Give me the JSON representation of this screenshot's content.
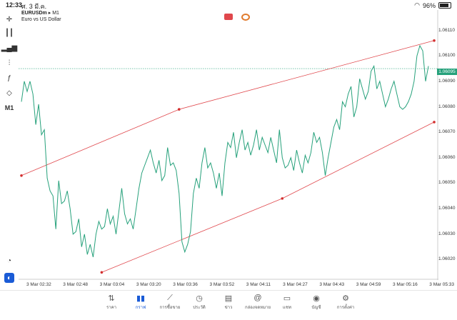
{
  "status_bar": {
    "time": "12:33",
    "date": "ศ. 3 มี.ค.",
    "battery": "96%"
  },
  "symbol": {
    "name": "EURUSDm",
    "timeframe": "M1",
    "description": "Euro vs US Dollar"
  },
  "sidebar": {
    "timeframe_label": "M1"
  },
  "price_axis": {
    "labels": [
      "1.06110",
      "1.06100",
      "1.06090",
      "1.06080",
      "1.06070",
      "1.06060",
      "1.06050",
      "1.06040",
      "1.06030",
      "1.06020"
    ],
    "current_price": "1.06095"
  },
  "time_axis": {
    "labels": [
      "3 Mar 02:32",
      "3 Mar 02:48",
      "3 Mar 03:04",
      "3 Mar 03:20",
      "3 Mar 03:36",
      "3 Mar 03:52",
      "3 Mar 04:11",
      "3 Mar 04:27",
      "3 Mar 04:43",
      "3 Mar 04:59",
      "3 Mar 05:16",
      "3 Mar 05:33"
    ]
  },
  "colors": {
    "line": "#26a17b",
    "channel": "#e0474c",
    "accent": "#1a5bd6"
  },
  "chart_data": {
    "type": "line",
    "x_unit": "time index (minutes)",
    "ylim": [
      1.06012,
      1.06118
    ],
    "series": [
      {
        "values": [
          1.06082,
          1.0609,
          1.06086,
          1.0609,
          1.06085,
          1.06073,
          1.06081,
          1.06069,
          1.06071,
          1.06052,
          1.06047,
          1.06045,
          1.06032,
          1.06051,
          1.06042,
          1.06043,
          1.06047,
          1.0604,
          1.0603,
          1.06031,
          1.06036,
          1.06025,
          1.0603,
          1.06022,
          1.06026,
          1.06021,
          1.0603,
          1.06035,
          1.06032,
          1.06033,
          1.0604,
          1.06034,
          1.06037,
          1.0603,
          1.06039,
          1.06048,
          1.06038,
          1.06034,
          1.06036,
          1.06032,
          1.0604,
          1.06048,
          1.06054,
          1.06057,
          1.0606,
          1.06063,
          1.06058,
          1.06054,
          1.06059,
          1.06051,
          1.06053,
          1.06064,
          1.06057,
          1.06058,
          1.06055,
          1.06046,
          1.06027,
          1.06023,
          1.06026,
          1.06031,
          1.06046,
          1.06052,
          1.06048,
          1.06058,
          1.06064,
          1.06056,
          1.06058,
          1.06054,
          1.06048,
          1.06054,
          1.06045,
          1.06058,
          1.06066,
          1.06064,
          1.0607,
          1.0606,
          1.06066,
          1.06071,
          1.06063,
          1.06066,
          1.06061,
          1.06065,
          1.06071,
          1.06063,
          1.06068,
          1.06065,
          1.06062,
          1.06068,
          1.06063,
          1.06058,
          1.06071,
          1.0606,
          1.06056,
          1.06057,
          1.0606,
          1.06055,
          1.06063,
          1.06058,
          1.06054,
          1.06061,
          1.06058,
          1.06062,
          1.0607,
          1.06066,
          1.06068,
          1.06062,
          1.06053,
          1.0606,
          1.06066,
          1.06072,
          1.06075,
          1.06071,
          1.06082,
          1.0608,
          1.06085,
          1.06088,
          1.06076,
          1.0608,
          1.06091,
          1.06087,
          1.06083,
          1.06086,
          1.06094,
          1.06096,
          1.06087,
          1.0609,
          1.06085,
          1.0608,
          1.06083,
          1.06087,
          1.0609,
          1.06085,
          1.0608,
          1.06079,
          1.0608,
          1.06082,
          1.06085,
          1.0609,
          1.061,
          1.06104,
          1.06102,
          1.0609,
          1.06096
        ]
      }
    ],
    "channel": {
      "upper": [
        {
          "x": 0,
          "y": 1.06053
        },
        {
          "x": 55,
          "y": 1.06079
        },
        {
          "x": 144,
          "y": 1.06106
        }
      ],
      "lower": [
        {
          "x": 28,
          "y": 1.06015
        },
        {
          "x": 91,
          "y": 1.06044
        },
        {
          "x": 144,
          "y": 1.06074
        }
      ]
    }
  },
  "tabs": [
    {
      "label": "ราคา",
      "icon": "sort-icon",
      "glyph": "⇅"
    },
    {
      "label": "กราฟ",
      "icon": "candles-icon",
      "glyph": "▮▮",
      "active": true
    },
    {
      "label": "การซื้อขาย",
      "icon": "trade-icon",
      "glyph": "⟋"
    },
    {
      "label": "ประวัติ",
      "icon": "history-icon",
      "glyph": "◷"
    },
    {
      "label": "ข่าว",
      "icon": "news-icon",
      "glyph": "▤"
    },
    {
      "label": "กล่องจดหมาย",
      "icon": "mail-icon",
      "glyph": "@"
    },
    {
      "label": "แชท",
      "icon": "chat-icon",
      "glyph": "▭"
    },
    {
      "label": "บัญชี",
      "icon": "account-icon",
      "glyph": "◉"
    },
    {
      "label": "การตั้งค่า",
      "icon": "settings-icon",
      "glyph": "⚙"
    }
  ]
}
